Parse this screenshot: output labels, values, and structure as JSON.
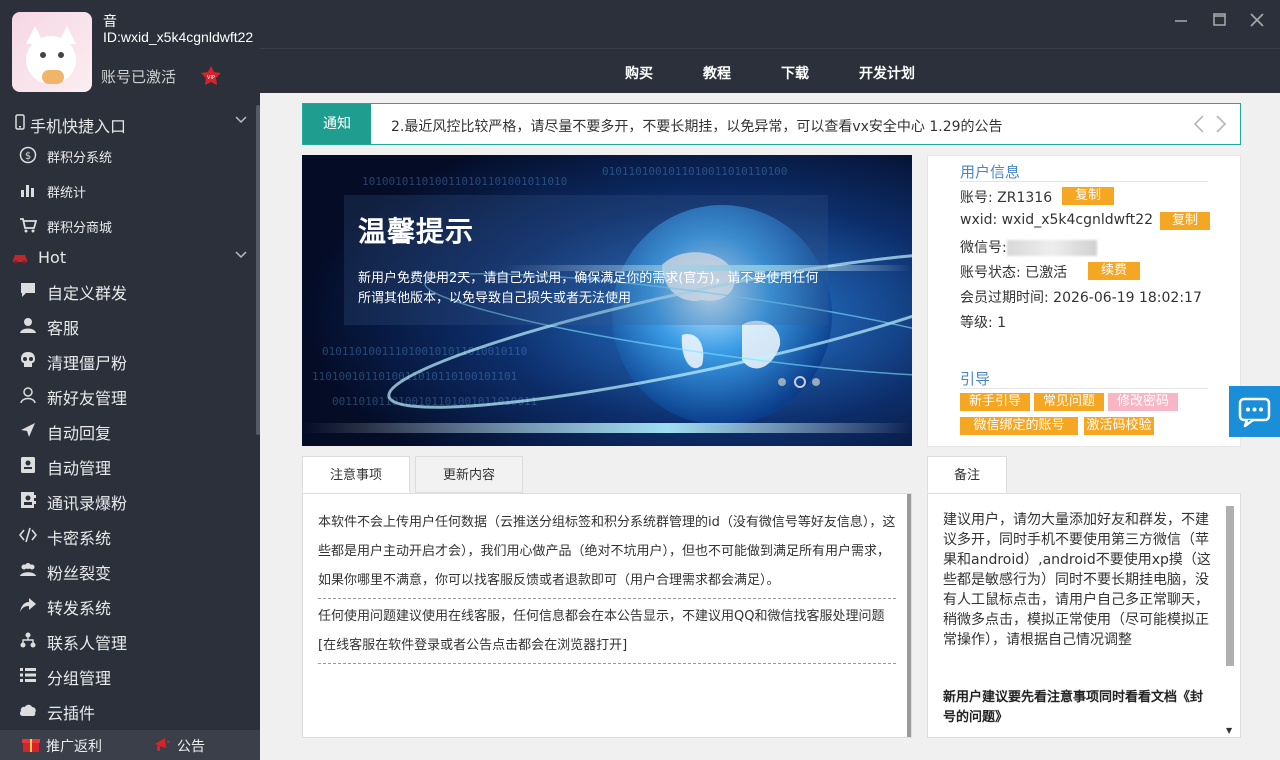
{
  "profile": {
    "nickname": "音",
    "id": "ID:wxid_x5k4cgnldwft22",
    "status": "账号已激活",
    "vip_label": "VIP"
  },
  "sidebar": {
    "group_mobile": "手机快捷入口",
    "mobile_items": [
      {
        "label": "群积分系统",
        "icon": "dollar-circle-icon"
      },
      {
        "label": "群统计",
        "icon": "bar-chart-icon"
      },
      {
        "label": "群积分商城",
        "icon": "cart-icon"
      }
    ],
    "group_hot": "Hot",
    "hot_items": [
      {
        "label": "自定义群发",
        "icon": "chat-bubble-icon"
      },
      {
        "label": "客服",
        "icon": "user-icon"
      },
      {
        "label": "清理僵尸粉",
        "icon": "skull-icon"
      },
      {
        "label": "新好友管理",
        "icon": "user-outline-icon"
      },
      {
        "label": "自动回复",
        "icon": "send-icon"
      },
      {
        "label": "自动管理",
        "icon": "id-card-icon"
      },
      {
        "label": "通讯录爆粉",
        "icon": "contacts-icon"
      },
      {
        "label": "卡密系统",
        "icon": "code-icon"
      },
      {
        "label": "粉丝裂变",
        "icon": "users-icon"
      },
      {
        "label": "转发系统",
        "icon": "share-icon"
      },
      {
        "label": "联系人管理",
        "icon": "sitemap-icon"
      },
      {
        "label": "分组管理",
        "icon": "list-icon"
      },
      {
        "label": "云插件",
        "icon": "cloud-icon"
      }
    ],
    "footer": {
      "promo": "推广返利",
      "announce": "公告"
    }
  },
  "topnav": [
    "购买",
    "教程",
    "下载",
    "开发计划"
  ],
  "notice": {
    "tag": "通知",
    "text": "2.最近风控比较严格，请尽量不要多开，不要长期挂，以免异常，可以查看vx安全中心 1.29的公告"
  },
  "banner": {
    "title": "温馨提示",
    "text": "新用户免费使用2天，请自己先试用，确保满足你的需求(官方)，请不要使用任何所谓其他版本，以免导致自己损失或者无法使用"
  },
  "userinfo": {
    "section_title": "用户信息",
    "account_label": "账号: ZR1316",
    "wxid_label": "wxid: wxid_x5k4cgnldwft22",
    "wechat_label": "微信号:",
    "status_label": "账号状态: 已激活",
    "expire_label": "会员过期时间: 2026-06-19 18:02:17",
    "level_label": "等级: 1",
    "copy_btn": "复制",
    "renew_btn": "续费",
    "guide_title": "引导",
    "guide_buttons": [
      "新手引导",
      "常见问题",
      "修改密码",
      "微信绑定的账号",
      "激活码校验"
    ]
  },
  "tabs": {
    "tab1": "注意事项",
    "tab2": "更新内容",
    "para1": "本软件不会上传用户任何数据（云推送分组标签和积分系统群管理的id（没有微信号等好友信息），这些都是用户主动开启才会），我们用心做产品（绝对不坑用户），但也不可能做到满足所有用户需求，如果你哪里不满意，你可以找客服反馈或者退款即可（用户合理需求都会满足）。",
    "para2": "任何使用问题建议使用在线客服，任何信息都会在本公告显示，不建议用QQ和微信找客服处理问题[在线客服在软件登录或者公告点击都会在浏览器打开]"
  },
  "remarks": {
    "tab": "备注",
    "text": "建议用户，请勿大量添加好友和群发，不建议多开，同时手机不要使用第三方微信（苹果和android）,android不要使用xp摸（这些都是敏感行为）同时不要长期挂电脑，没有人工鼠标点击，请用户自己多正常聊天，稍微多点击，模拟正常使用（尽可能模拟正常操作），请根据自己情况调整",
    "bold": "新用户建议要先看注意事项同时看看文档《封号的问题》"
  },
  "colors": {
    "sidebar": "#2b303b",
    "accent": "#1f9e90",
    "button": "#f5a623",
    "link": "#4a86c5"
  }
}
